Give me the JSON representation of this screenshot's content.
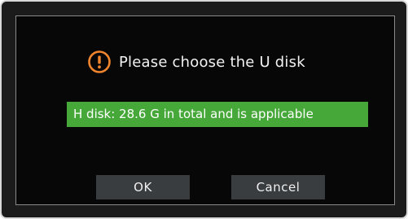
{
  "dialog": {
    "title": "Please choose the U disk",
    "icon": "exclamation-circle-icon",
    "colors": {
      "icon": "#f0852d",
      "selected_item": "#47a83a",
      "button": "#3a3d40",
      "background": "#070707"
    },
    "disks": [
      {
        "label": "H disk: 28.6 G in total and is applicable",
        "selected": true
      }
    ],
    "buttons": {
      "ok_label": "OK",
      "cancel_label": "Cancel"
    }
  }
}
